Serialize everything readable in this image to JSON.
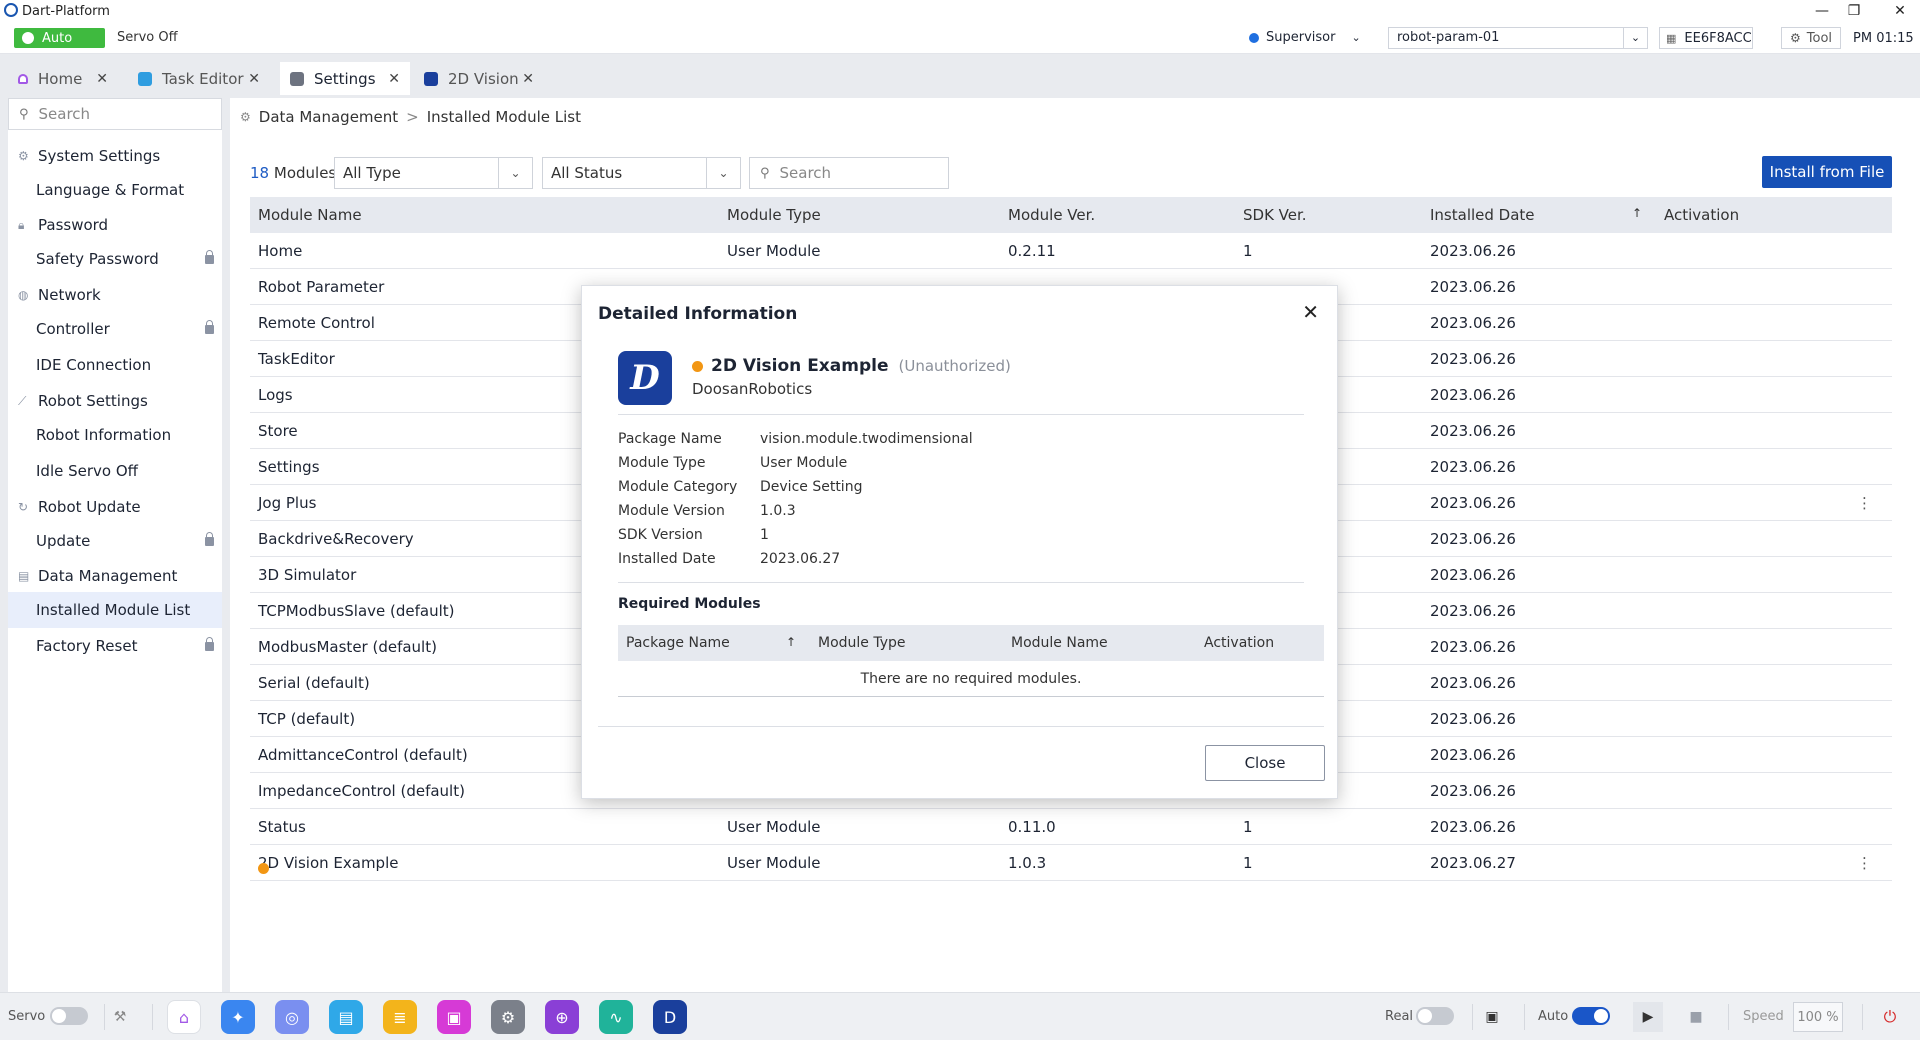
{
  "window": {
    "title": "Dart-Platform",
    "minimize": "—",
    "restore": "❐",
    "close": "✕"
  },
  "status": {
    "mode_badge": "Auto",
    "servo_state": "Servo Off",
    "user_role": "Supervisor",
    "robot_param": "robot-param-01",
    "serial": "EE6F8ACC",
    "tool_label": "Tool",
    "time": "PM 01:15"
  },
  "tabs": [
    {
      "label": "Home",
      "color": "#a259e6"
    },
    {
      "label": "Task Editor",
      "color": "#2f9de0"
    },
    {
      "label": "Settings",
      "color": "#6d7380"
    },
    {
      "label": "2D Vision",
      "color": "#1a3f9c"
    }
  ],
  "sidebar": {
    "search_placeholder": "Search",
    "groups": [
      {
        "label": "System Settings",
        "icon": "gear-icon",
        "items": [
          {
            "label": "Language & Format",
            "locked": false
          }
        ]
      },
      {
        "label": "Password",
        "icon": "lock-icon",
        "items": [
          {
            "label": "Safety Password",
            "locked": true
          }
        ]
      },
      {
        "label": "Network",
        "icon": "globe-icon",
        "items": [
          {
            "label": "Controller",
            "locked": true
          },
          {
            "label": "IDE Connection",
            "locked": false
          }
        ]
      },
      {
        "label": "Robot Settings",
        "icon": "robot-arm-icon",
        "items": [
          {
            "label": "Robot Information",
            "locked": false
          },
          {
            "label": "Idle Servo Off",
            "locked": false
          }
        ]
      },
      {
        "label": "Robot Update",
        "icon": "refresh-icon",
        "items": [
          {
            "label": "Update",
            "locked": true
          }
        ]
      },
      {
        "label": "Data Management",
        "icon": "document-icon",
        "items": [
          {
            "label": "Installed Module List",
            "locked": false,
            "selected": true
          },
          {
            "label": "Factory Reset",
            "locked": true
          }
        ]
      }
    ]
  },
  "breadcrumb": {
    "parent": "Data Management",
    "separator": ">",
    "current": "Installed Module List"
  },
  "toolbar": {
    "count_number": "18",
    "count_label": "Modules",
    "type_filter": "All Type",
    "status_filter": "All Status",
    "search_placeholder": "Search",
    "install_button": "Install from File"
  },
  "table": {
    "headers": [
      "Module Name",
      "Module Type",
      "Module Ver.",
      "SDK Ver.",
      "Installed Date",
      "Activation"
    ],
    "sort_indicator": "↑",
    "rows": [
      {
        "name": "Home",
        "type": "User Module",
        "ver": "0.2.11",
        "sdk": "1",
        "date": "2023.06.26"
      },
      {
        "name": "Robot Parameter",
        "type": "",
        "ver": "",
        "sdk": "",
        "date": "2023.06.26"
      },
      {
        "name": "Remote Control",
        "type": "",
        "ver": "",
        "sdk": "",
        "date": "2023.06.26"
      },
      {
        "name": "TaskEditor",
        "type": "",
        "ver": "",
        "sdk": "",
        "date": "2023.06.26"
      },
      {
        "name": "Logs",
        "type": "",
        "ver": "",
        "sdk": "",
        "date": "2023.06.26"
      },
      {
        "name": "Store",
        "type": "",
        "ver": "",
        "sdk": "",
        "date": "2023.06.26"
      },
      {
        "name": "Settings",
        "type": "",
        "ver": "",
        "sdk": "",
        "date": "2023.06.26"
      },
      {
        "name": "Jog Plus",
        "type": "",
        "ver": "",
        "sdk": "",
        "date": "2023.06.26",
        "kebab": true
      },
      {
        "name": "Backdrive&Recovery",
        "type": "",
        "ver": "",
        "sdk": "",
        "date": "2023.06.26"
      },
      {
        "name": "3D Simulator",
        "type": "",
        "ver": "",
        "sdk": "",
        "date": "2023.06.26"
      },
      {
        "name": "TCPModbusSlave (default)",
        "type": "",
        "ver": "",
        "sdk": "",
        "date": "2023.06.26"
      },
      {
        "name": "ModbusMaster (default)",
        "type": "",
        "ver": "",
        "sdk": "",
        "date": "2023.06.26"
      },
      {
        "name": "Serial (default)",
        "type": "",
        "ver": "",
        "sdk": "",
        "date": "2023.06.26"
      },
      {
        "name": "TCP (default)",
        "type": "",
        "ver": "",
        "sdk": "",
        "date": "2023.06.26"
      },
      {
        "name": "AdmittanceControl (default)",
        "type": "",
        "ver": "",
        "sdk": "",
        "date": "2023.06.26"
      },
      {
        "name": "ImpedanceControl (default)",
        "type": "",
        "ver": "",
        "sdk": "",
        "date": "2023.06.26"
      },
      {
        "name": "Status",
        "type": "User Module",
        "ver": "0.11.0",
        "sdk": "1",
        "date": "2023.06.26"
      },
      {
        "name": "2D Vision Example",
        "type": "User Module",
        "ver": "1.0.3",
        "sdk": "1",
        "date": "2023.06.27",
        "warn": true,
        "kebab": true
      }
    ]
  },
  "dialog": {
    "title": "Detailed Information",
    "close_x": "✕",
    "logo_letter": "D",
    "module_name": "2D Vision Example",
    "auth_status": "(Unauthorized)",
    "vendor": "DoosanRobotics",
    "fields": [
      {
        "key": "Package Name",
        "value": "vision.module.twodimensional"
      },
      {
        "key": "Module Type",
        "value": "User Module"
      },
      {
        "key": "Module Category",
        "value": "Device Setting"
      },
      {
        "key": "Module Version",
        "value": "1.0.3"
      },
      {
        "key": "SDK Version",
        "value": "1"
      },
      {
        "key": "Installed Date",
        "value": "2023.06.27"
      }
    ],
    "required_title": "Required Modules",
    "required_headers": [
      "Package Name",
      "Module Type",
      "Module Name",
      "Activation"
    ],
    "required_sort": "↑",
    "required_empty": "There are no required modules.",
    "close_button": "Close"
  },
  "bottombar": {
    "servo_label": "Servo",
    "real_label": "Real",
    "auto_label": "Auto",
    "speed_label": "Speed",
    "speed_value": "100 %",
    "apps": [
      {
        "name": "home-app-icon",
        "color": "#ffffff",
        "glyph": "⌂",
        "fg": "#a259e6"
      },
      {
        "name": "jog-app-icon",
        "color": "#3a86f0",
        "glyph": "✦",
        "fg": "#ffffff"
      },
      {
        "name": "remote-app-icon",
        "color": "#7a8ff0",
        "glyph": "◎",
        "fg": "#ffffff"
      },
      {
        "name": "task-editor-app-icon",
        "color": "#2fa8e8",
        "glyph": "▤",
        "fg": "#ffffff"
      },
      {
        "name": "logs-app-icon",
        "color": "#f3b41b",
        "glyph": "≣",
        "fg": "#ffffff"
      },
      {
        "name": "store-app-icon",
        "color": "#d63ad6",
        "glyph": "▣",
        "fg": "#ffffff"
      },
      {
        "name": "settings-app-icon",
        "color": "#7b808a",
        "glyph": "⚙",
        "fg": "#ffffff"
      },
      {
        "name": "target-app-icon",
        "color": "#8a3fd6",
        "glyph": "⊕",
        "fg": "#ffffff"
      },
      {
        "name": "status-app-icon",
        "color": "#20b39a",
        "glyph": "∿",
        "fg": "#ffffff"
      },
      {
        "name": "vision-app-icon",
        "color": "#1a3f9c",
        "glyph": "D",
        "fg": "#ffffff"
      }
    ]
  }
}
